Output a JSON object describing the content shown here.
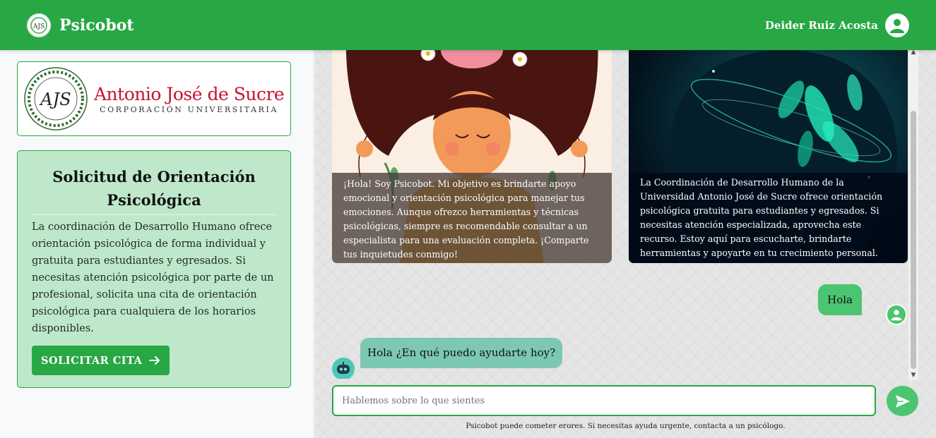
{
  "header": {
    "app_name": "Psicobot",
    "user_name": "Deider Ruiz Acosta",
    "logo_initials": "AJS"
  },
  "sidebar": {
    "university": {
      "initials": "AJS",
      "name": "Antonio José de Sucre",
      "subtitle": "CORPORACIÓN UNIVERSITARIA"
    },
    "request_card": {
      "title": "Solicitud de Orientación Psicológica",
      "text": "La coordinación de Desarrollo Humano ofrece orientación psicológica de forma individual y gratuita para estudiantes y egresados. Si necesitas atención psicológica por parte de un profesional, solicita una cita de orientación psicológica para cualquiera de los horarios disponibles.",
      "button_label": "SOLICITAR CITA"
    }
  },
  "chat": {
    "cards": [
      {
        "caption": "¡Hola! Soy Psicobot. Mi objetivo es brindarte apoyo emocional y orientación psicológica para manejar tus emociones. Aunque ofrezco herramientas y técnicas psicológicas, siempre es recomendable consultar a un especialista para una evaluación completa. ¡Comparte tus inquietudes conmigo!"
      },
      {
        "caption": "La Coordinación de Desarrollo Humano de la Universidad Antonio José de Sucre ofrece orientación psicológica gratuita para estudiantes y egresados. Si necesitas atención especializada, aprovecha este recurso. Estoy aquí para escucharte, brindarte herramientas y apoyarte en tu crecimiento personal."
      }
    ],
    "messages": [
      {
        "from": "user",
        "text": "Hola"
      },
      {
        "from": "bot",
        "text": "Hola ¿En qué puedo ayudarte hoy?"
      }
    ],
    "input_placeholder": "Hablemos sobre lo que sientes",
    "disclaimer": "Psicobot puede cometer erores. Si necesitas ayuda urgente, contacta a un psicólogo."
  },
  "colors": {
    "primary": "#28a745",
    "user_bubble": "#4cc571",
    "bot_bubble": "#7cc8b4",
    "card_bg": "#bfe8cb",
    "university_red": "#c8102e"
  },
  "icons": [
    "brand-logo-icon",
    "user-icon",
    "arrow-right-icon",
    "send-icon",
    "robot-icon"
  ]
}
